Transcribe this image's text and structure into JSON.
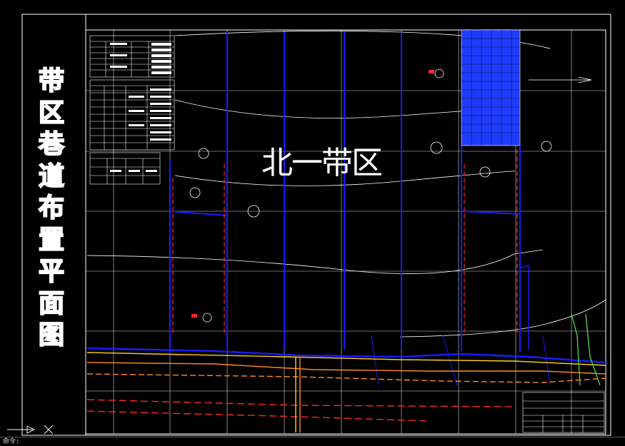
{
  "title_vertical": [
    "带",
    "区",
    "巷",
    "道",
    "布",
    "置",
    "平",
    "面",
    "图"
  ],
  "zone_label": "北一带区",
  "colors": {
    "background": "#000000",
    "frame": "#ffffff",
    "tunnel_blue": "#1a1aff",
    "fill_blue": "#1e3cff",
    "grid_white": "#ffffff",
    "red": "#ff2a2a",
    "yellow": "#ffd21e",
    "orange": "#ff8a1e",
    "green": "#4cd04c"
  },
  "ucs_icon": "ucs-axis-icon",
  "command_line": "命令:"
}
